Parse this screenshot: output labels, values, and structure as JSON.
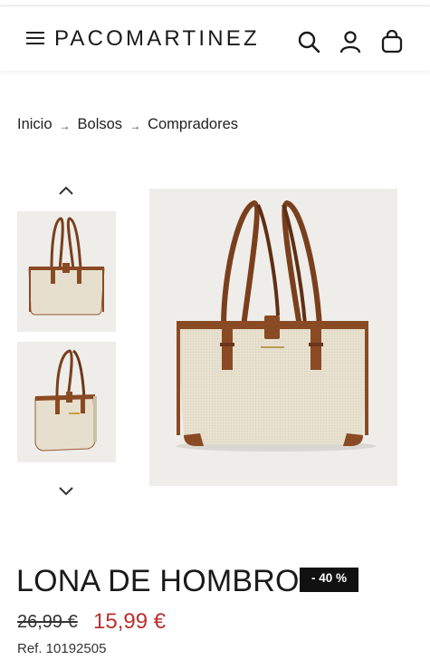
{
  "header": {
    "logo": "PACOMARTINEZ",
    "icons": [
      "menu-icon",
      "search-icon",
      "user-icon",
      "bag-icon"
    ]
  },
  "breadcrumb": {
    "items": [
      "Inicio",
      "Bolsos",
      "Compradores"
    ],
    "separator": "→"
  },
  "gallery": {
    "thumbnails": [
      "bag-front-view",
      "bag-side-view"
    ],
    "controls": [
      "chevron-up-icon",
      "chevron-down-icon"
    ]
  },
  "product": {
    "name": "LONA DE HOMBRO",
    "discount": "- 40 %",
    "old_price": "26,99 €",
    "price": "15,99 €",
    "ref": "Ref. 10192505"
  },
  "colors": {
    "price": "#b8312f",
    "badge_bg": "#111111",
    "leather": "#8a4a24",
    "canvas": "#e7e0cf",
    "image_bg": "#eeede9"
  }
}
